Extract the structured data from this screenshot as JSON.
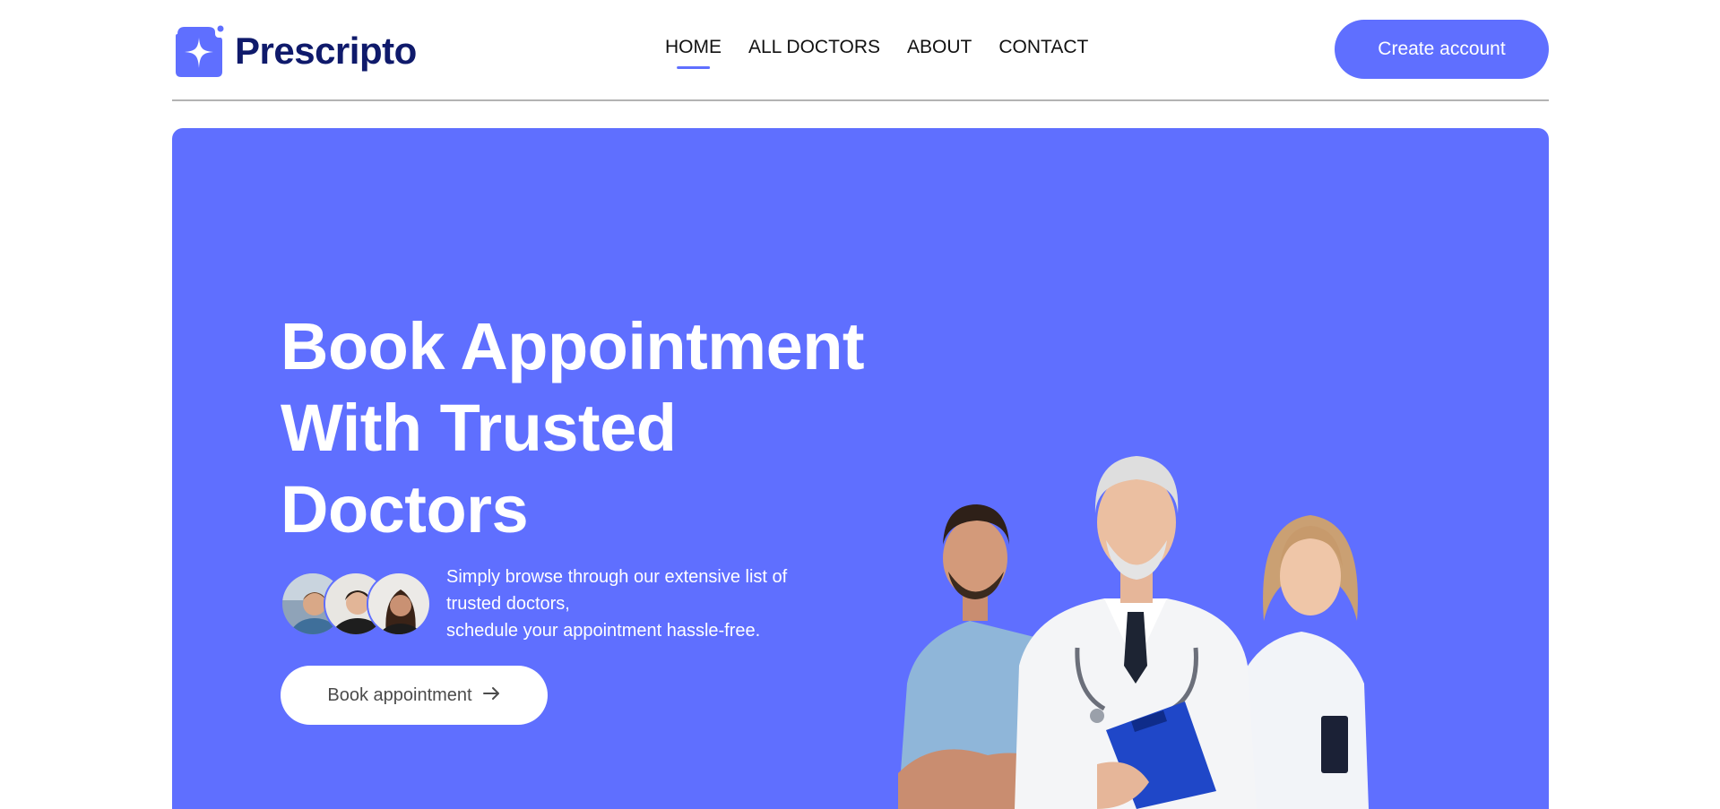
{
  "brand": {
    "name": "Prescripto",
    "color": "#5f6fff",
    "text_color": "#0f1a6b"
  },
  "nav": {
    "items": [
      {
        "label": "HOME",
        "active": true
      },
      {
        "label": "ALL DOCTORS",
        "active": false
      },
      {
        "label": "ABOUT",
        "active": false
      },
      {
        "label": "CONTACT",
        "active": false
      }
    ],
    "create_account_label": "Create account"
  },
  "hero": {
    "title_lines": [
      "Book Appointment",
      "With Trusted",
      "Doctors"
    ],
    "description_lines": [
      "Simply browse through our extensive list of",
      "trusted doctors,",
      "schedule your appointment hassle-free."
    ],
    "book_button_label": "Book appointment",
    "book_button_icon": "arrow-right-icon",
    "background": "#5f6fff"
  }
}
